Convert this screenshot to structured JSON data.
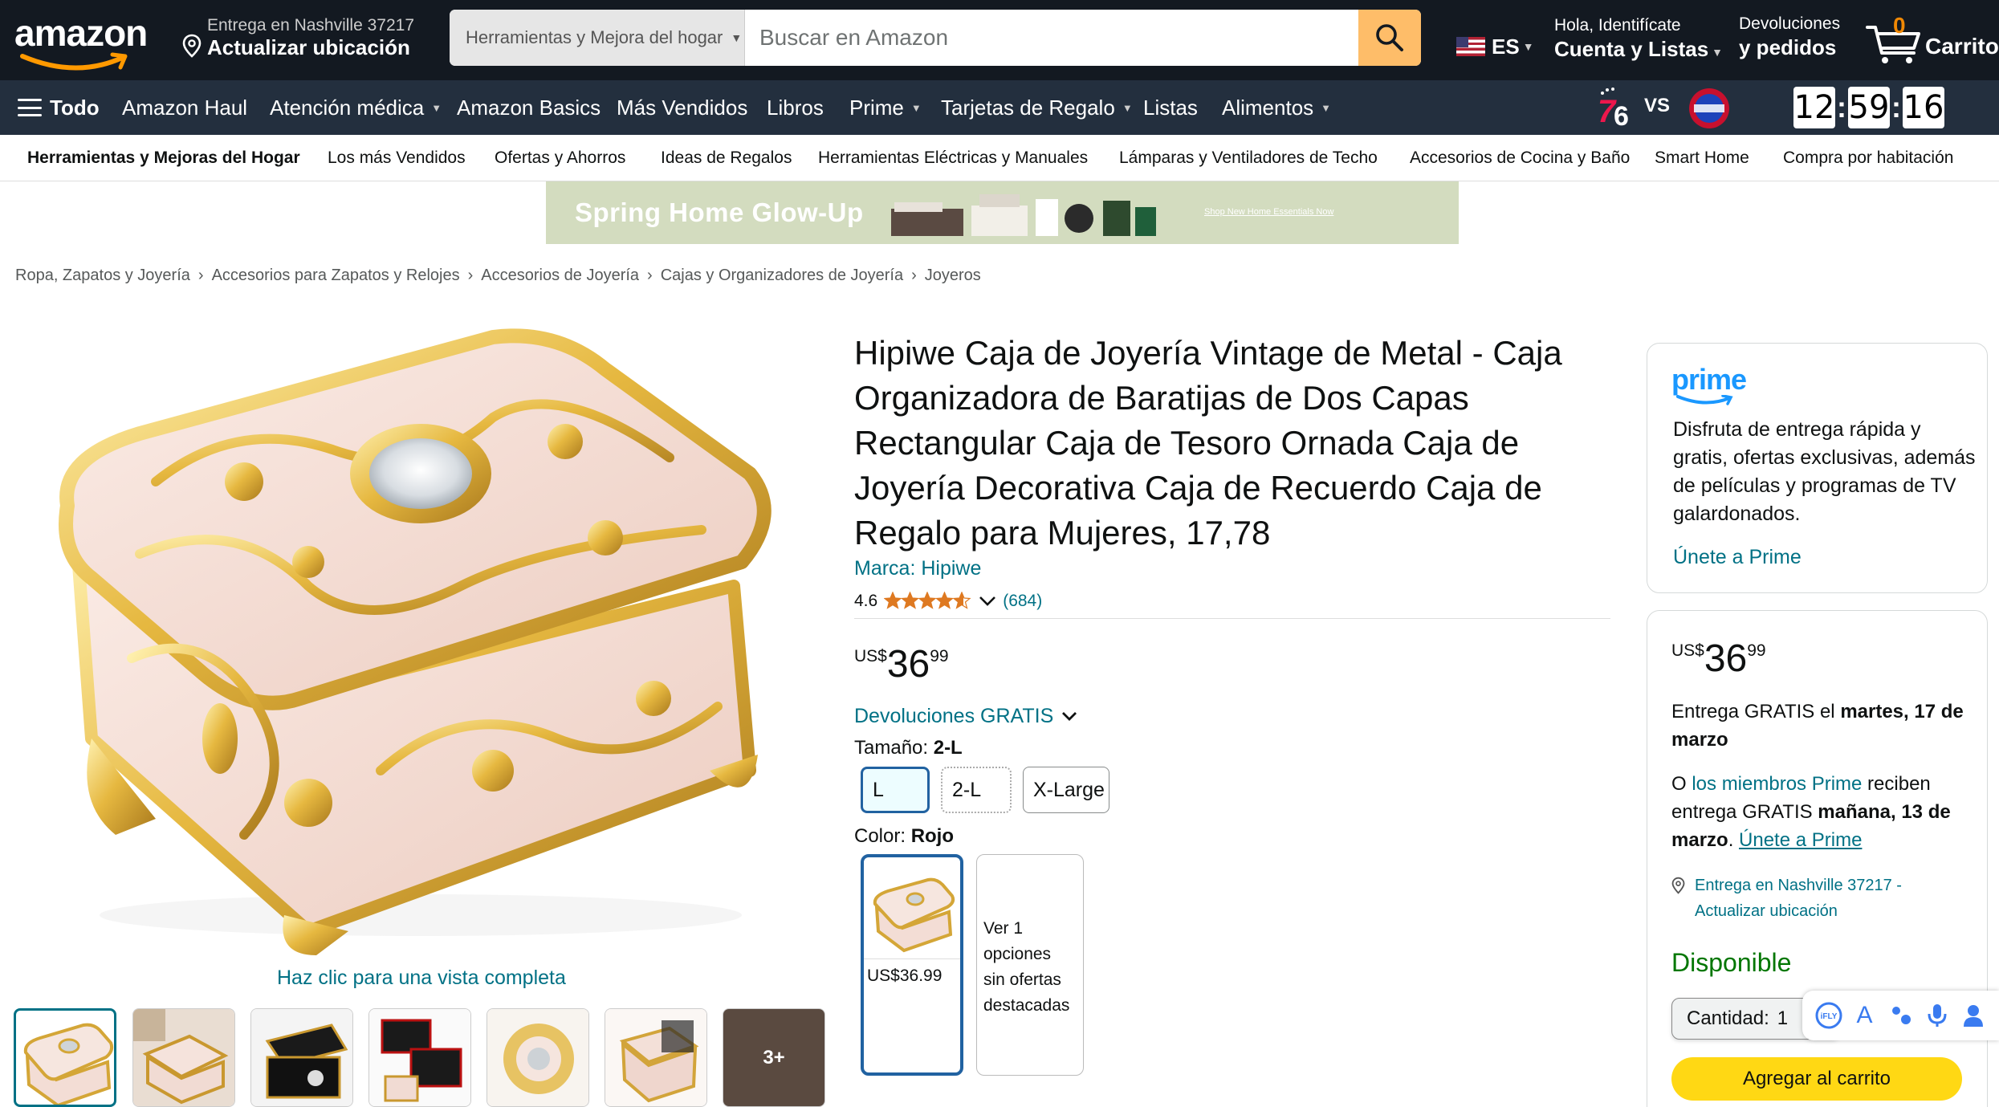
{
  "header": {
    "logo": "amazon",
    "deliver_line1": "Entrega en Nashville 37217",
    "deliver_line2": "Actualizar ubicación",
    "search_category": "Herramientas y Mejora del hogar",
    "search_placeholder": "Buscar en Amazon",
    "lang": "ES",
    "account_line1": "Hola, Identifícate",
    "account_line2": "Cuenta y Listas",
    "returns_line1": "Devoluciones",
    "returns_line2": "y pedidos",
    "cart_count": "0",
    "cart_label": "Carrito"
  },
  "subnav": {
    "items": [
      "Todo",
      "Amazon Haul",
      "Atención médica",
      "Amazon Basics",
      "Más Vendidos",
      "Libros",
      "Prime",
      "Tarjetas de Regalo",
      "Listas",
      "Alimentos"
    ],
    "game_vs": "VS",
    "team1": "76",
    "timer": [
      "12",
      "59",
      "16"
    ]
  },
  "categories": [
    "Herramientas y Mejoras del Hogar",
    "Los más Vendidos",
    "Ofertas y Ahorros",
    "Ideas de Regalos",
    "Herramientas Eléctricas y Manuales",
    "Lámparas y Ventiladores de Techo",
    "Accesorios de Cocina y Baño",
    "Smart Home",
    "Compra por habitación"
  ],
  "banner": {
    "headline": "Spring Home Glow-Up",
    "link": "Shop New Home Essentials Now"
  },
  "breadcrumb": [
    "Ropa, Zapatos y Joyería",
    "Accesorios para Zapatos y Relojes",
    "Accesorios de Joyería",
    "Cajas y Organizadores de Joyería",
    "Joyeros"
  ],
  "product": {
    "title": "Hipiwe Caja de Joyería Vintage de Metal - Caja Organizadora de Baratijas de Dos Capas Rectangular Caja de Tesoro Ornada Caja de Joyería Decorativa Caja de Recuerdo Caja de Regalo para Mujeres, 17,78",
    "brand": "Marca: Hipiwe",
    "rating": "4.6",
    "rating_value": 4.6,
    "review_count": "(684)",
    "price_currency": "US$",
    "price_whole": "36",
    "price_fraction": "99",
    "returns": "Devoluciones GRATIS",
    "size_label": "Tamaño: ",
    "size_selected": "2-L",
    "sizes": [
      "L",
      "2-L",
      "X-Large"
    ],
    "color_label": "Color: ",
    "color_selected": "Rojo",
    "color_price": "US$36.99",
    "color_other": "Ver 1 opciones sin ofertas destacadas",
    "full_view": "Haz clic para una vista completa",
    "more_thumbs": "3+"
  },
  "prime_box": {
    "logo": "prime",
    "text": "Disfruta de entrega rápida y gratis, ofertas exclusivas, además de películas y programas de TV galardonados.",
    "link": "Únete a Prime"
  },
  "buy_box": {
    "price_currency": "US$",
    "price_whole": "36",
    "price_fraction": "99",
    "delivery_prefix": "Entrega GRATIS el ",
    "delivery_date": "martes, 17 de marzo",
    "prime_prefix": "O ",
    "prime_link": "los miembros Prime",
    "prime_mid": " reciben entrega GRATIS ",
    "prime_date": "mañana, 13 de marzo",
    "prime_dot": ". ",
    "prime_join": "Únete a Prime",
    "location": "Entrega en Nashville 37217 - Actualizar ubicación",
    "availability": "Disponible",
    "qty_label": "Cantidad:",
    "qty_value": "1",
    "add_to_cart": "Agregar al carrito"
  },
  "ime": {
    "brand": "iFLY",
    "letter": "A"
  },
  "colors": {
    "nav_dark": "#131921",
    "nav_sub": "#232f3e",
    "search_btn": "#febd69",
    "link": "#007185",
    "star": "#de7921",
    "cart_button": "#ffd814",
    "available": "#007600",
    "selected_border": "#2162a1"
  }
}
